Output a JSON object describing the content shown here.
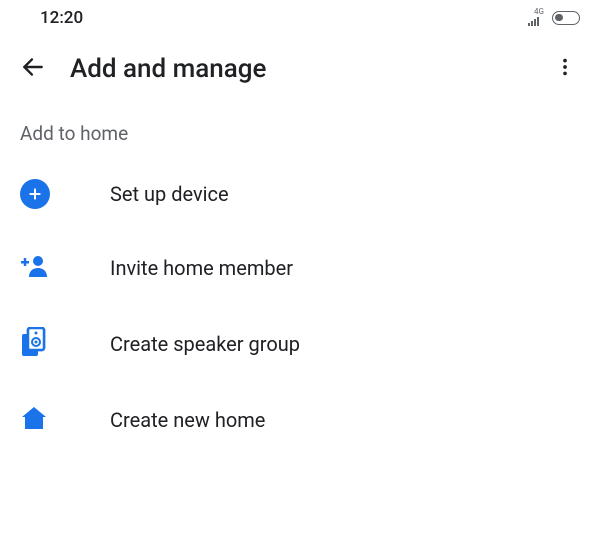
{
  "status": {
    "time": "12:20",
    "network": "4G"
  },
  "appbar": {
    "title": "Add and manage"
  },
  "section": {
    "header": "Add to home"
  },
  "items": [
    {
      "label": "Set up device",
      "icon": "plus-circle-icon"
    },
    {
      "label": "Invite home member",
      "icon": "person-add-icon"
    },
    {
      "label": "Create speaker group",
      "icon": "speaker-group-icon"
    },
    {
      "label": "Create new home",
      "icon": "home-icon"
    }
  ]
}
